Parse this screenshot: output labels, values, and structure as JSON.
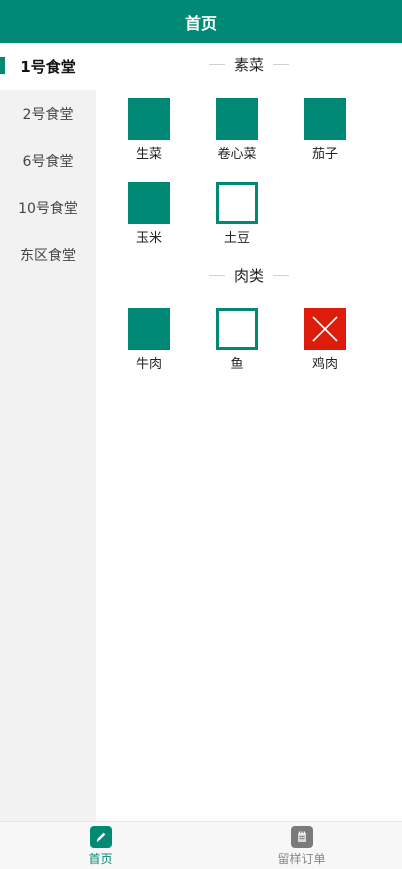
{
  "header": {
    "title": "首页"
  },
  "sidebar": {
    "items": [
      {
        "label": "1号食堂",
        "active": true
      },
      {
        "label": "2号食堂"
      },
      {
        "label": "6号食堂"
      },
      {
        "label": "10号食堂"
      },
      {
        "label": "东区食堂"
      }
    ]
  },
  "sections": [
    {
      "title": "素菜",
      "dishes": [
        {
          "name": "生菜",
          "status": "filled"
        },
        {
          "name": "卷心菜",
          "status": "filled"
        },
        {
          "name": "茄子",
          "status": "filled"
        },
        {
          "name": "玉米",
          "status": "filled"
        },
        {
          "name": "土豆",
          "status": "outline"
        }
      ]
    },
    {
      "title": "肉类",
      "dishes": [
        {
          "name": "牛肉",
          "status": "filled"
        },
        {
          "name": "鱼",
          "status": "outline"
        },
        {
          "name": "鸡肉",
          "status": "soldout"
        }
      ]
    }
  ],
  "tabbar": {
    "items": [
      {
        "label": "首页",
        "icon": "pencil-icon",
        "active": true
      },
      {
        "label": "留样订单",
        "icon": "notepad-icon",
        "active": false
      }
    ]
  },
  "colors": {
    "primary": "#008a76",
    "soldout": "#dd1c0c",
    "active_tab_text": "#008a76",
    "inactive_tab_icon": "#7a7a7a",
    "inactive_tab_text": "#888888"
  }
}
